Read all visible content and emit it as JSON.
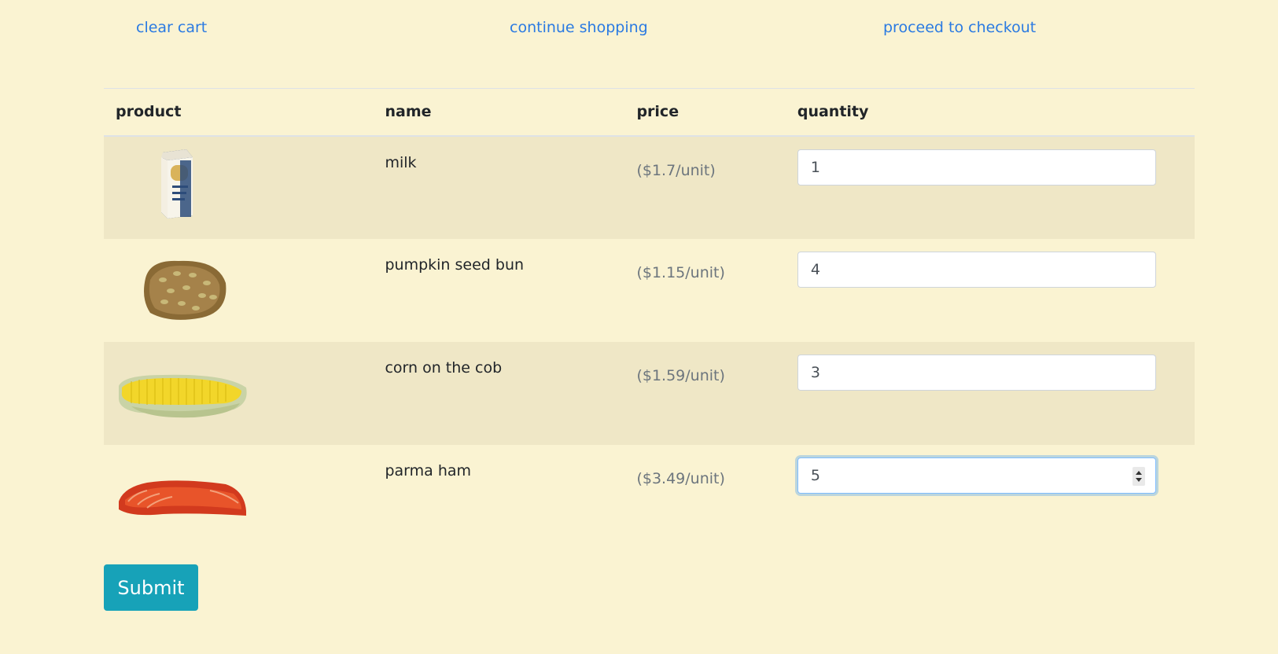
{
  "nav": {
    "clear_cart": "clear cart",
    "continue_shopping": "continue shopping",
    "proceed_to_checkout": "proceed to checkout"
  },
  "table": {
    "headers": [
      "product",
      "name",
      "price",
      "quantity"
    ],
    "rows": [
      {
        "image": "milk-carton-image",
        "name": "milk",
        "price": "($1.7/unit)",
        "quantity": "1"
      },
      {
        "image": "pumpkin-seed-bun-image",
        "name": "pumpkin seed bun",
        "price": "($1.15/unit)",
        "quantity": "4"
      },
      {
        "image": "corn-cob-image",
        "name": "corn on the cob",
        "price": "($1.59/unit)",
        "quantity": "3"
      },
      {
        "image": "parma-ham-image",
        "name": "parma ham",
        "price": "($3.49/unit)",
        "quantity": "5"
      }
    ]
  },
  "submit_label": "Submit",
  "colors": {
    "background": "#faf3d2",
    "stripe": "#efe7c6",
    "link": "#2a7ae2",
    "button": "#17a2b8"
  }
}
